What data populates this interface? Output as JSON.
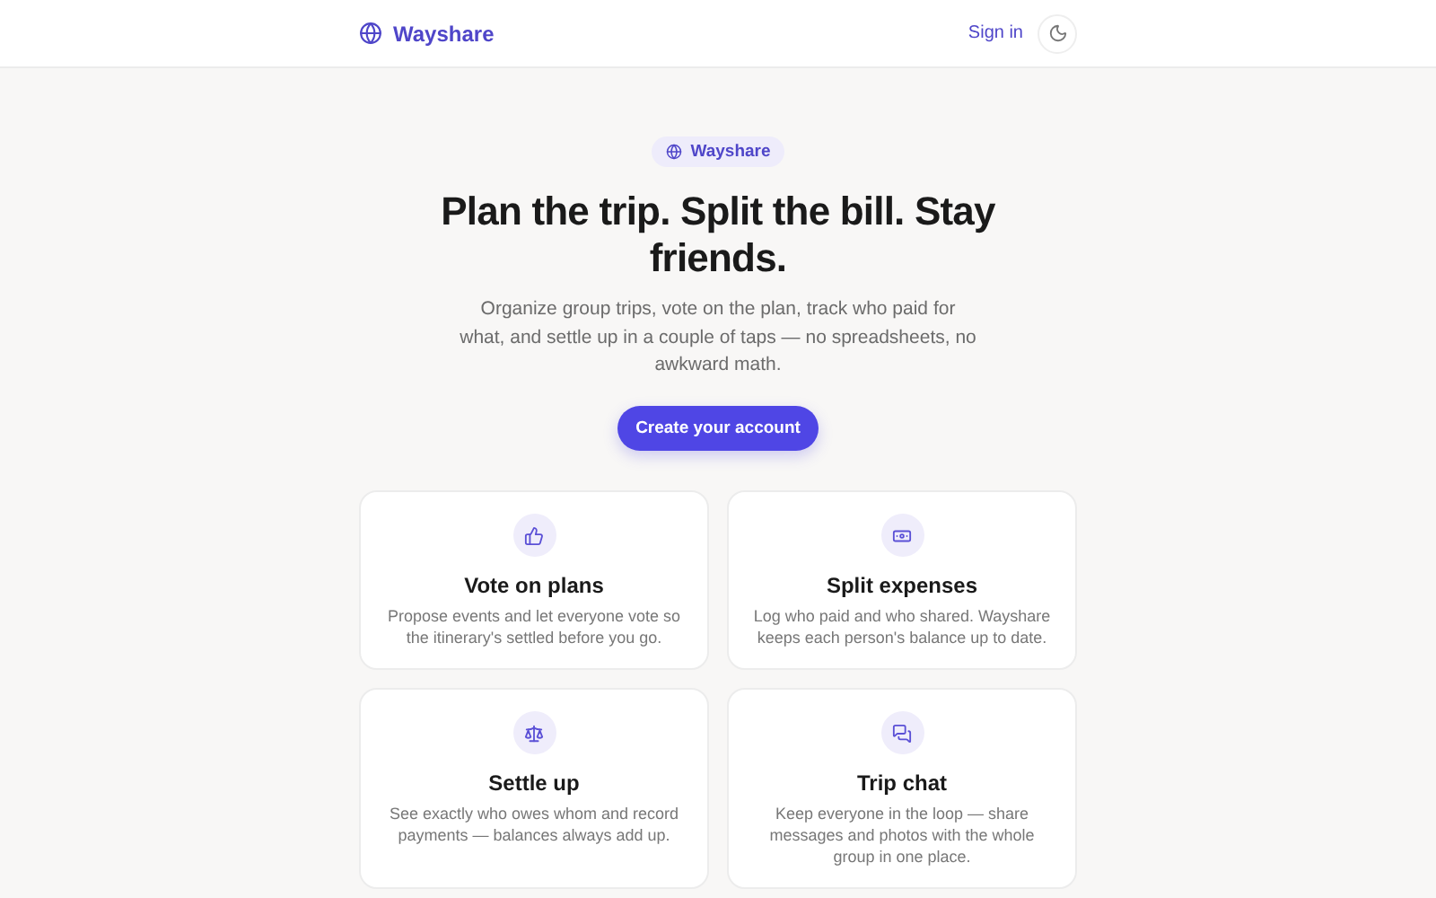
{
  "header": {
    "brand": "Wayshare",
    "sign_in": "Sign in"
  },
  "hero": {
    "badge": "Wayshare",
    "title": "Plan the trip. Split the bill. Stay friends.",
    "subtitle": "Organize group trips, vote on the plan, track who paid for what, and settle up in a couple of taps — no spreadsheets, no awkward math.",
    "cta": "Create your account"
  },
  "features": [
    {
      "title": "Vote on plans",
      "text": "Propose events and let everyone vote so the itinerary's settled before you go."
    },
    {
      "title": "Split expenses",
      "text": "Log who paid and who shared. Wayshare keeps each person's balance up to date."
    },
    {
      "title": "Settle up",
      "text": "See exactly who owes whom and record payments — balances always add up."
    },
    {
      "title": "Trip chat",
      "text": "Keep everyone in the loop — share messages and photos with the whole group in one place."
    }
  ]
}
